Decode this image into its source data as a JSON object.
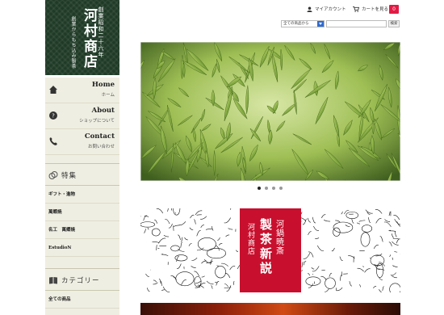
{
  "logo": {
    "name": "河村商店",
    "established": "創業昭和二十六年",
    "tagline": "創業からもち込み製茶"
  },
  "nav": [
    {
      "en": "Home",
      "jp": "ホーム",
      "icon": "home-icon"
    },
    {
      "en": "About",
      "jp": "ショップについて",
      "icon": "question-icon"
    },
    {
      "en": "Contact",
      "jp": "お問い合わせ",
      "icon": "phone-icon"
    }
  ],
  "features": {
    "heading": "特集",
    "items": [
      "ギフト・進物",
      "萬郷焼",
      "名工　萬郷焼",
      "EstudioN"
    ]
  },
  "categories": {
    "heading": "カテゴリー",
    "items": [
      "全ての商品"
    ]
  },
  "header": {
    "account_label": "マイアカウント",
    "cart_label": "カートを見る",
    "cart_count": "0"
  },
  "search": {
    "select_value": "全ての商品から",
    "button_label": "検索",
    "placeholder": ""
  },
  "hero": {
    "slide_count": 4,
    "active_slide": 1
  },
  "banner": {
    "title": "製茶新説",
    "left_label": "河村商店",
    "right_label": "河鍋暁斎"
  },
  "colors": {
    "logo_bg": "#1f3a26",
    "sidebar_bg": "#efeee2",
    "badge": "#e21b45",
    "banner_red": "#c8102e"
  }
}
